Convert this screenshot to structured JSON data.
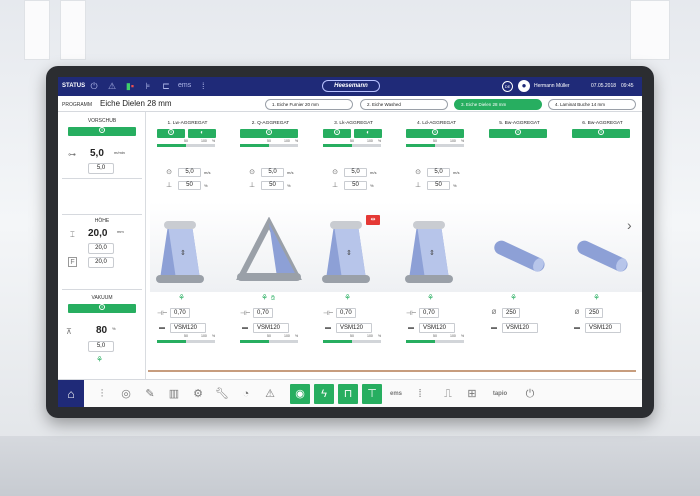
{
  "header": {
    "status_label": "STATUS",
    "icons": [
      "power-icon",
      "warning-icon",
      "robot-arm-icon",
      "ladder-icon",
      "machine-icon",
      "ems",
      "level-icon"
    ],
    "ems_label": "ems",
    "logo_text": "Heesemann",
    "language": "DE",
    "user_name": "Hermann Müller",
    "date": "07.05.2018",
    "time": "09:45"
  },
  "program": {
    "label": "PROGRAMM",
    "name": "Eiche Dielen 28 mm",
    "tabs": [
      {
        "label": "1. Eiche Furnier 20 mm",
        "active": false
      },
      {
        "label": "2. Eiche Washed",
        "active": false
      },
      {
        "label": "3. Eiche Dielen 28 mm",
        "active": true
      },
      {
        "label": "4. Laminat Buche 14 mm",
        "active": false
      }
    ]
  },
  "left_panel": {
    "vorschub": {
      "title": "VORSCHUB",
      "value": "5,0",
      "unit": "m/min",
      "set_value": "5,0"
    },
    "hoehe": {
      "title": "HÖHE",
      "value": "20,0",
      "unit": "mm",
      "set_value_1": "20,0",
      "set_value_2": "20,0"
    },
    "vakuum": {
      "title": "VAKUUM",
      "value": "80",
      "unit": "%",
      "set_value": "5,0"
    }
  },
  "aggregates": [
    {
      "title": "1. Lw-AGGREGAT",
      "buttons": 2,
      "bar_top": 0.5,
      "speed": "5,0",
      "speed_unit": "m/s",
      "pct": "50",
      "pct_unit": "%",
      "machine": "belt",
      "fan": "fan-icon",
      "val": "0,70",
      "code": "VSM120",
      "bar_bottom": 0.5
    },
    {
      "title": "2. Q-AGGREGAT",
      "buttons": 1,
      "bar_top": 0.5,
      "speed": "5,0",
      "speed_unit": "m/s",
      "pct": "50",
      "pct_unit": "%",
      "machine": "triangle",
      "fan": "fan-icon",
      "val": "0,70",
      "code": "VSM120",
      "bar_bottom": 0.5
    },
    {
      "title": "3. Lk-AGGREGAT",
      "buttons": 2,
      "bar_top": 0.5,
      "speed": "5,0",
      "speed_unit": "m/s",
      "pct": "50",
      "pct_unit": "%",
      "machine": "belt",
      "fan": "fan-icon",
      "val": "0,70",
      "code": "VSM120",
      "bar_bottom": 0.5
    },
    {
      "title": "4. Ld-AGGREGAT",
      "buttons": 1,
      "bar_top": 0.5,
      "speed": "5,0",
      "speed_unit": "m/s",
      "pct": "50",
      "pct_unit": "%",
      "machine": "belt",
      "fan": "fan-icon",
      "val": "0,70",
      "code": "VSM120",
      "bar_bottom": 0.5
    },
    {
      "title": "5. Bw-AGGREGAT",
      "buttons": 1,
      "machine": "roller",
      "fan": "fan-icon",
      "val": "250",
      "code": "VSM120"
    },
    {
      "title": "6. Bw-AGGREGAT",
      "buttons": 1,
      "machine": "roller",
      "fan": "fan-icon",
      "val": "250",
      "code": "VSM120"
    }
  ],
  "bar_labels": {
    "mid": "50",
    "end": "100",
    "unit": "%"
  },
  "bottom_toolbar": {
    "items": [
      "home-icon",
      "brush-icon",
      "disc-icon",
      "pen-icon",
      "chart-icon",
      "gears-icon",
      "wrench-icon",
      "gauge-icon",
      "warning-icon",
      "sanding-icon",
      "lightning-icon",
      "machine-a-icon",
      "machine-b-icon",
      "ems",
      "level-icon",
      "camera-icon",
      "network-icon",
      "tapio",
      "power-icon"
    ],
    "ems_label": "ems",
    "tapio_label": "tapio"
  },
  "colors": {
    "brand": "#1f2a78",
    "accent": "#27ae60"
  }
}
